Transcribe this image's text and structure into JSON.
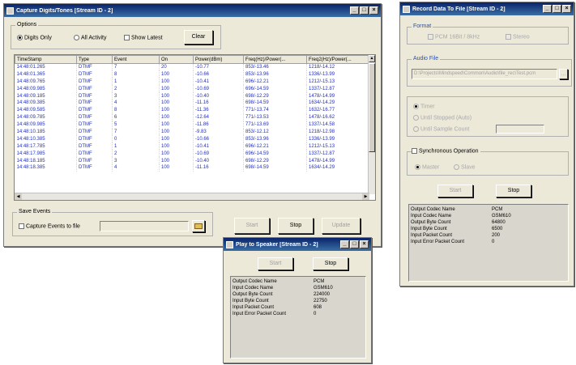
{
  "capture": {
    "title": "Capture Digits/Tones [Stream ID - 2]",
    "options_legend": "Options",
    "digits_only": "Digits Only",
    "all_activity": "All Activity",
    "show_latest": "Show Latest",
    "clear": "Clear",
    "columns": [
      "TimeStamp",
      "Type",
      "Event",
      "On",
      "Power(dBm)",
      "Freq(Hz)/Power(...",
      "Freq2(Hz)/Power(..."
    ],
    "rows": [
      [
        "14:48:01.265",
        "DTMF",
        "7",
        "20",
        "-10.77",
        "853/-13.46",
        "1218/-14.12"
      ],
      [
        "14:48:01.365",
        "DTMF",
        "8",
        "100",
        "-10.66",
        "853/-13.96",
        "1336/-13.99"
      ],
      [
        "14:48:09.765",
        "DTMF",
        "1",
        "100",
        "-10.41",
        "696/-12.21",
        "1212/-15.13"
      ],
      [
        "14:48:09.985",
        "DTMF",
        "2",
        "100",
        "-10.69",
        "696/-14.59",
        "1337/-12.87"
      ],
      [
        "14:48:09.185",
        "DTMF",
        "3",
        "100",
        "-10.40",
        "698/-12.29",
        "1478/-14.99"
      ],
      [
        "14:48:09.385",
        "DTMF",
        "4",
        "100",
        "-11.16",
        "698/-14.59",
        "1634/-14.29"
      ],
      [
        "14:48:09.585",
        "DTMF",
        "8",
        "100",
        "-11.36",
        "771/-13.74",
        "1632/-16.77"
      ],
      [
        "14:48:09.785",
        "DTMF",
        "6",
        "100",
        "-12.64",
        "771/-13.53",
        "1478/-16.62"
      ],
      [
        "14:48:09.985",
        "DTMF",
        "5",
        "100",
        "-11.86",
        "771/-13.69",
        "1337/-14.58"
      ],
      [
        "14:48:10.185",
        "DTMF",
        "7",
        "100",
        "-9.83",
        "853/-12.12",
        "1218/-12.98"
      ],
      [
        "14:48:10.385",
        "DTMF",
        "0",
        "100",
        "-10.66",
        "853/-13.96",
        "1336/-13.99"
      ],
      [
        "14:48:17.785",
        "DTMF",
        "1",
        "100",
        "-10.41",
        "696/-12.21",
        "1212/-15.13"
      ],
      [
        "14:48:17.985",
        "DTMF",
        "2",
        "100",
        "-10.69",
        "696/-14.59",
        "1337/-12.87"
      ],
      [
        "14:48:18.185",
        "DTMF",
        "3",
        "100",
        "-10.40",
        "698/-12.29",
        "1478/-14.99"
      ],
      [
        "14:48:18.385",
        "DTMF",
        "4",
        "100",
        "-11.16",
        "698/-14.59",
        "1634/-14.29"
      ]
    ],
    "save_legend": "Save Events",
    "capture_to_file": "Capture Events to file",
    "start": "Start",
    "stop": "Stop",
    "update": "Update"
  },
  "record": {
    "title": "Record Data To File [Stream ID - 2]",
    "format_legend": "Format",
    "format_pcm": "PCM 16Bit / 8kHz",
    "format_stereo": "Stereo",
    "audio_file_legend": "Audio File",
    "audio_file_path": "D:\\Projects\\Mindspeed\\Common\\Audio\\file_rec\\Test.pcm",
    "opt_timer": "Timer",
    "opt_until_stopped": "Until Stopped (Auto)",
    "opt_until_count": "Until Sample Count",
    "sync_label": "Synchronous Operation",
    "sync_master": "Master",
    "sync_slave": "Slave",
    "start": "Start",
    "stop": "Stop",
    "stats": [
      {
        "k": "Output Codec Name",
        "v": "PCM"
      },
      {
        "k": "Input Codec Name",
        "v": "GSM610"
      },
      {
        "k": "Output Byte Count",
        "v": "64800"
      },
      {
        "k": "Input Byte Count",
        "v": "6500"
      },
      {
        "k": "Input Packet Count",
        "v": "200"
      },
      {
        "k": "Input Error Packet Count",
        "v": "0"
      }
    ]
  },
  "play": {
    "title": "Play to Speaker [Stream ID - 2]",
    "start": "Start",
    "stop": "Stop",
    "stats": [
      {
        "k": "Output Codec Name",
        "v": "PCM"
      },
      {
        "k": "Input Codec Name",
        "v": "GSM610"
      },
      {
        "k": "Output Byte Count",
        "v": "224000"
      },
      {
        "k": "Input Byte Count",
        "v": "22750"
      },
      {
        "k": "Input Packet Count",
        "v": "608"
      },
      {
        "k": "Input Error Packet Count",
        "v": "0"
      }
    ]
  }
}
